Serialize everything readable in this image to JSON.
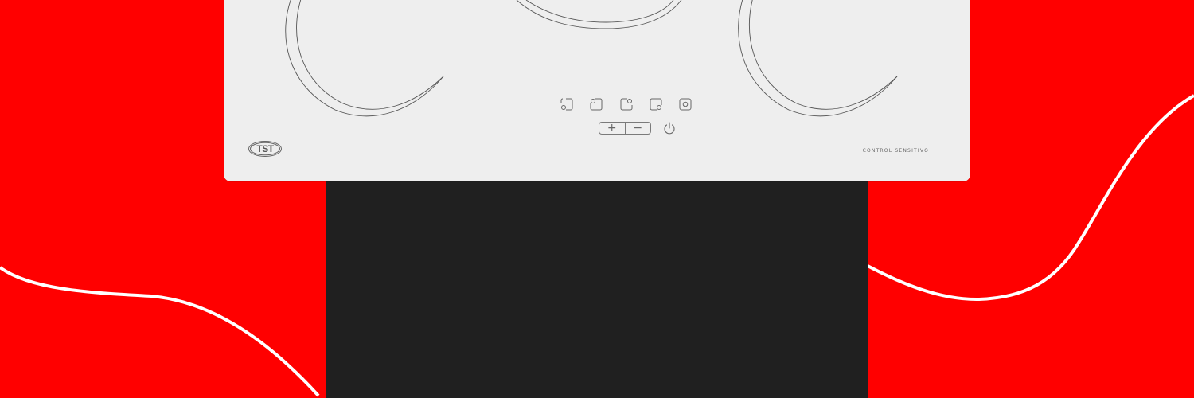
{
  "colors": {
    "background": "#ff0000",
    "cooktop": "#eeeeee",
    "cabinet": "#202020",
    "curves": "#ffffff"
  },
  "cooktop": {
    "brand_logo": "TST",
    "label": "CONTROL SENSITIVO",
    "zone_keys": [
      {
        "name": "zone-bottom-left-key-icon"
      },
      {
        "name": "zone-top-left-key-icon"
      },
      {
        "name": "zone-top-right-key-icon"
      },
      {
        "name": "zone-bottom-right-key-icon"
      },
      {
        "name": "zone-center-key-icon"
      }
    ],
    "stepper": {
      "plus": "+",
      "minus": "−"
    },
    "power_icon": "power-icon"
  }
}
